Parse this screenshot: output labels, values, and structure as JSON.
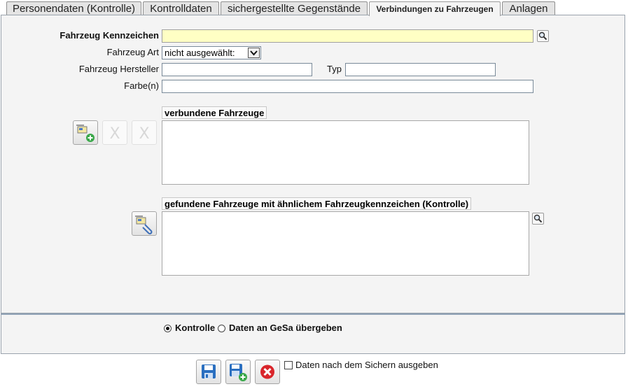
{
  "tabs": [
    {
      "label": "Personendaten (Kontrolle)",
      "active": false
    },
    {
      "label": "Kontrolldaten",
      "active": false
    },
    {
      "label": "sichergestellte Gegenstände",
      "active": false
    },
    {
      "label": "Verbindungen zu Fahrzeugen",
      "active": true
    },
    {
      "label": "Anlagen",
      "active": false
    }
  ],
  "form": {
    "kennzeichen_label": "Fahrzeug Kennzeichen",
    "kennzeichen_value": "",
    "art_label": "Fahrzeug Art",
    "art_selected": "nicht ausgewählt:",
    "hersteller_label": "Fahrzeug Hersteller",
    "hersteller_value": "",
    "typ_label": "Typ",
    "typ_value": "",
    "farbe_label": "Farbe(n)",
    "farbe_value": ""
  },
  "lists": {
    "connected_caption": "verbundene Fahrzeuge",
    "found_caption": "gefundene Fahrzeuge mit ähnlichem Fahrzeugkennzeichen (Kontrolle)",
    "remove_glyph": "X"
  },
  "mode": {
    "option1": "Kontrolle",
    "option2": "Daten an GeSa übergeben",
    "selected": "Kontrolle"
  },
  "footer": {
    "print_after_save_label": "Daten nach dem Sichern ausgeben"
  },
  "colors": {
    "required_field_bg": "#ffffc4",
    "panel_bg": "#f4f4f4",
    "cancel_red": "#d9262c",
    "save_blue": "#2a6fc0",
    "add_green": "#3aa84a"
  },
  "icons": [
    "search-icon",
    "add-vehicle-icon",
    "remove-icon",
    "attach-vehicle-icon",
    "save-icon",
    "save-new-icon",
    "cancel-icon"
  ]
}
